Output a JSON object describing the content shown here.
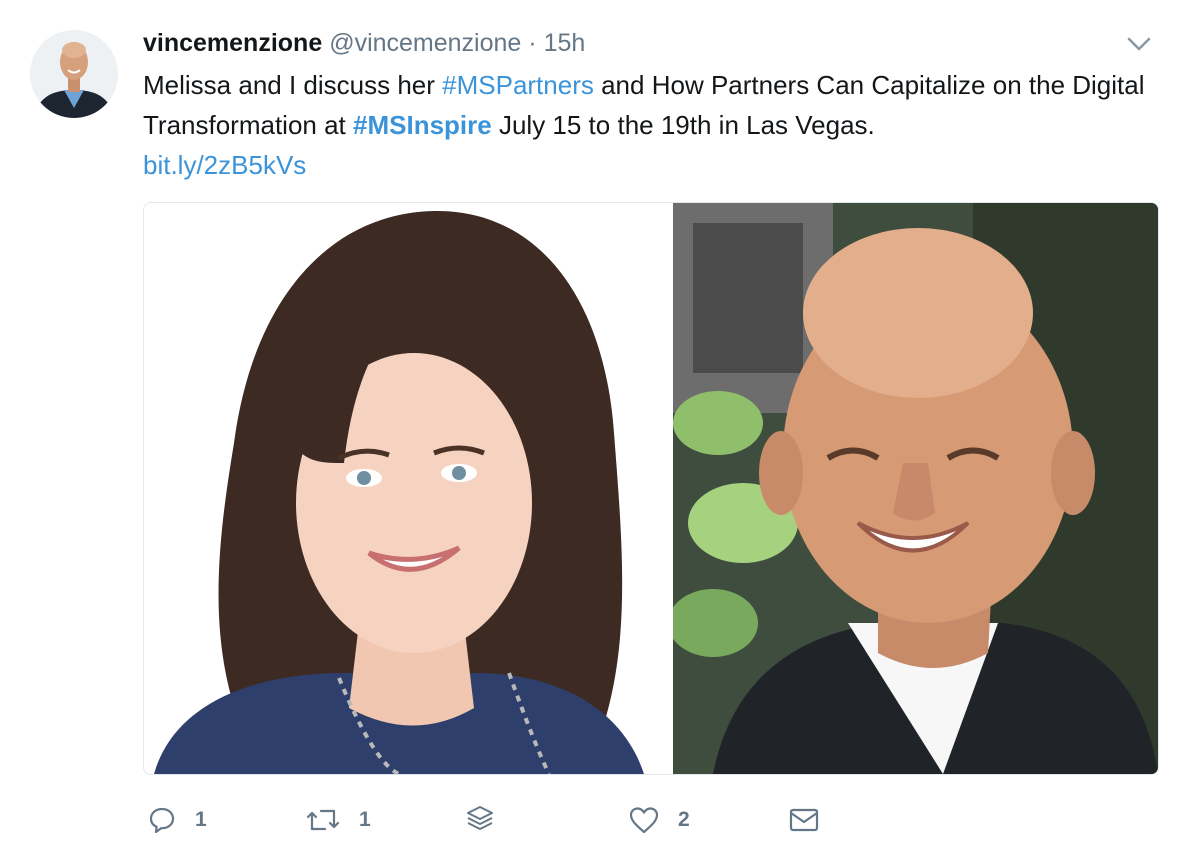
{
  "tweet": {
    "author": {
      "name": "vincemenzione",
      "handle": "@vincemenzione",
      "separator": "·",
      "time": "15h"
    },
    "text": {
      "part1": "Melissa and I discuss her ",
      "hashtag1": "#MSPartners",
      "part2": " and How Partners Can Capitalize on the Digital Transformation at ",
      "hashtag2": "#MSInspire",
      "part3": " July 15 to the 19th in Las Vegas.",
      "link": "bit.ly/2zB5kVs"
    },
    "actions": {
      "reply_count": "1",
      "retweet_count": "1",
      "like_count": "2"
    },
    "icons": {
      "caret": "chevron-down-icon",
      "reply": "reply-icon",
      "retweet": "retweet-icon",
      "stack": "layers-icon",
      "like": "heart-icon",
      "dm": "envelope-icon"
    },
    "colors": {
      "link": "#3b94d9",
      "secondary": "#657786",
      "text": "#14171a",
      "border": "#e1e8ed"
    }
  }
}
